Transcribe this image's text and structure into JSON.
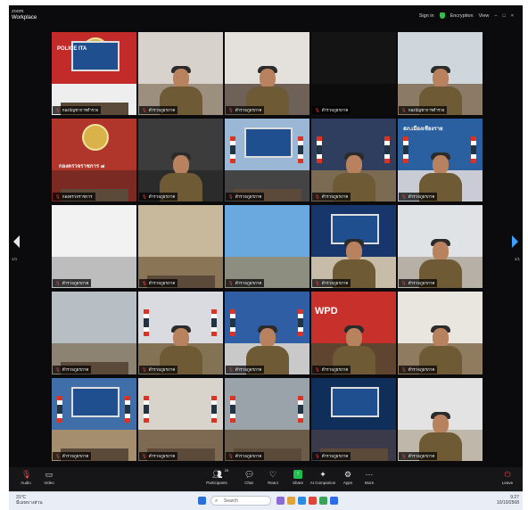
{
  "window": {
    "title_line1": "zoom",
    "title_line2": "Workplace",
    "sign_in": "Sign in",
    "encryption": "Encryption",
    "view": "View",
    "minimize": "–",
    "maximize": "□",
    "close": "×"
  },
  "nav": {
    "prev_label": "1/1",
    "next_label": "1/1"
  },
  "tiles": [
    {
      "name": "กองบัญชาการตำรวจ",
      "sign": "POLICE ITA",
      "theme": "presentation"
    },
    {
      "name": "ตำรวจภูธรภาค",
      "sign": "",
      "theme": "person-female"
    },
    {
      "name": "ตำรวจภูธรภาค",
      "sign": "",
      "theme": "person-desk"
    },
    {
      "name": "ตำรวจภูธรภาค",
      "sign": "",
      "theme": "dark"
    },
    {
      "name": "กองบัญชาการตำรวจ",
      "sign": "",
      "theme": "meeting-room"
    },
    {
      "name": "กองตรวจราชการ",
      "sign": "กองตรวจราชการ ๗",
      "theme": "red-sign"
    },
    {
      "name": "ตำรวจภูธรภาค",
      "sign": "",
      "theme": "green-door"
    },
    {
      "name": "ตำรวจภูธรภาค",
      "sign": "",
      "theme": "banner-room"
    },
    {
      "name": "ตำรวจภูธรภาค",
      "sign": "",
      "theme": "flags-room"
    },
    {
      "name": "ตำรวจภูธรภาค",
      "sign": "สภ.เมืองเชียงราย",
      "theme": "blue-room"
    },
    {
      "name": "ตำรวจภูธรภาค",
      "sign": "",
      "theme": "ceiling"
    },
    {
      "name": "ตำรวจภูธรภาค",
      "sign": "",
      "theme": "hall"
    },
    {
      "name": "ตำรวจภูธรภาค",
      "sign": "",
      "theme": "outdoor"
    },
    {
      "name": "ตำรวจภูธรภาค",
      "sign": "",
      "theme": "screen-room"
    },
    {
      "name": "ตำรวจภูธรภาค",
      "sign": "",
      "theme": "person-near"
    },
    {
      "name": "ตำรวจภูธรภาค",
      "sign": "",
      "theme": "office"
    },
    {
      "name": "ตำรวจภูธรภาค",
      "sign": "",
      "theme": "person-flags"
    },
    {
      "name": "ตำรวจภูธรภาค",
      "sign": "",
      "theme": "person-blue"
    },
    {
      "name": "ตำรวจภูธรภาค",
      "sign": "WPD",
      "theme": "person-red"
    },
    {
      "name": "ตำรวจภูธรภาค",
      "sign": "",
      "theme": "person-office"
    },
    {
      "name": "ตำรวจภูธรภาค",
      "sign": "",
      "theme": "conference"
    },
    {
      "name": "ตำรวจภูธรภาค",
      "sign": "",
      "theme": "long-table"
    },
    {
      "name": "ตำรวจภูธรภาค",
      "sign": "",
      "theme": "board-room"
    },
    {
      "name": "ตำรวจภูธรภาค",
      "sign": "",
      "theme": "digital-screen"
    },
    {
      "name": "ตำรวจภูธรภาค",
      "sign": "",
      "theme": "person-standing"
    }
  ],
  "controls": {
    "audio": "Audio",
    "video": "Video",
    "participants": "Participants",
    "participants_count": "25",
    "chat": "Chat",
    "react": "React",
    "share": "Share",
    "ai_companion": "AI Companion",
    "apps": "Apps",
    "more": "More",
    "leave": "Leave"
  },
  "taskbar": {
    "weather_temp": "31°C",
    "weather_desc": "มีเมฆบางส่วน",
    "search_placeholder": "Search",
    "tray_time": "9:27",
    "tray_date": "10/10/2568"
  },
  "colors": {
    "share_green": "#1fbf4f",
    "accent_blue": "#3ea0ff",
    "leave_red": "#e03c3c"
  }
}
